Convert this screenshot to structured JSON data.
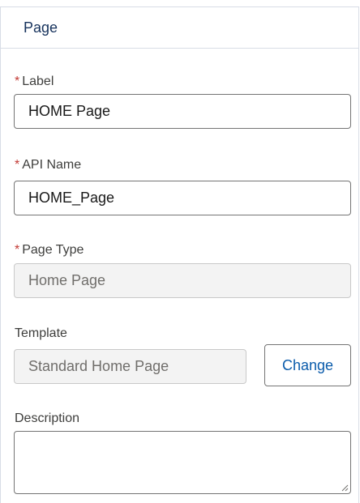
{
  "panel": {
    "title": "Page"
  },
  "fields": {
    "label": {
      "label": "Label",
      "required_mark": "*",
      "value": "HOME Page"
    },
    "api_name": {
      "label": "API Name",
      "required_mark": "*",
      "value": "HOME_Page"
    },
    "page_type": {
      "label": "Page Type",
      "required_mark": "*",
      "value": "Home Page"
    },
    "template": {
      "label": "Template",
      "value": "Standard Home Page",
      "change_label": "Change"
    },
    "description": {
      "label": "Description",
      "value": ""
    }
  },
  "colors": {
    "required": "#c23934",
    "link": "#0b5cab",
    "title": "#16325c",
    "readonly_bg": "#f3f3f3"
  },
  "icons": {
    "resize": "resize-grip-icon"
  }
}
